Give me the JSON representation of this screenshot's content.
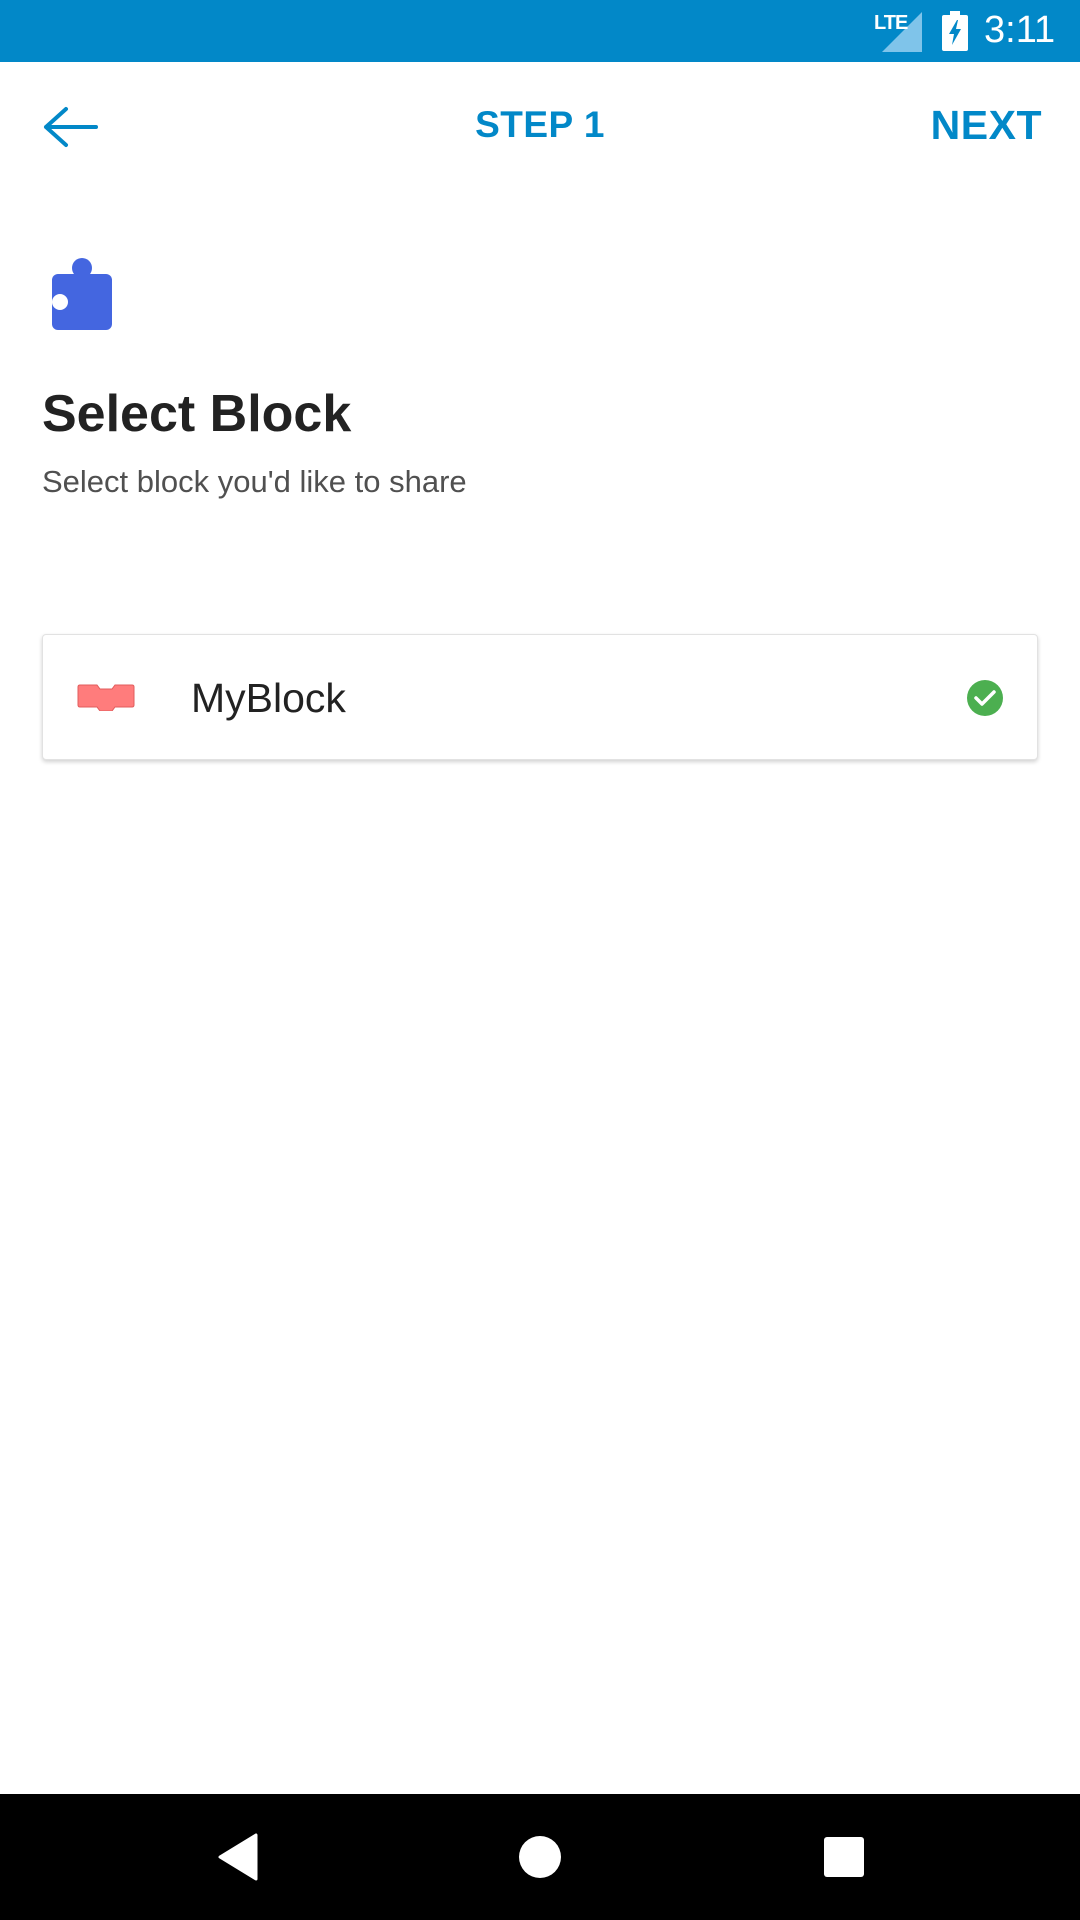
{
  "status_bar": {
    "network": "LTE",
    "time": "3:11",
    "background_color": "#0288c8"
  },
  "app_bar": {
    "back_icon": "arrow-left-icon",
    "title": "STEP 1",
    "next_label": "NEXT",
    "accent_color": "#0288c8"
  },
  "header": {
    "icon": "puzzle-piece-icon",
    "icon_color": "#4466e0",
    "title": "Select Block",
    "subtitle": "Select block you'd like to share"
  },
  "blocks": [
    {
      "name": "MyBlock",
      "icon": "block-shape-icon",
      "block_color": "#ff7c7c",
      "selected": true,
      "check_icon": "check-circle-icon",
      "check_color": "#4caf50"
    }
  ],
  "nav_bar": {
    "back_icon": "nav-back-icon",
    "home_icon": "nav-home-icon",
    "recents_icon": "nav-recents-icon"
  }
}
